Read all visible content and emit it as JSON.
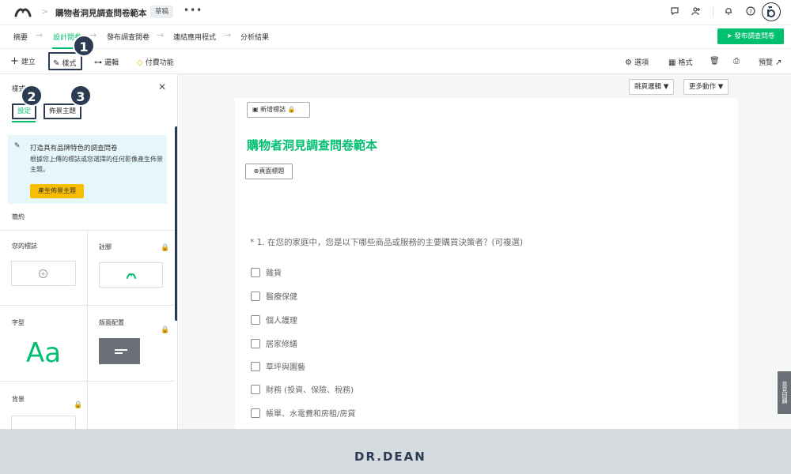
{
  "topbar": {
    "survey_title": "購物者洞見調查問卷範本",
    "draft_badge": "草稿",
    "more": "•••",
    "icons": [
      "chat-icon",
      "add-user-icon",
      "bell-icon",
      "help-icon",
      "user-avatar"
    ]
  },
  "steps": [
    {
      "label": "摘要",
      "active": false
    },
    {
      "label": "設計問卷",
      "active": true
    },
    {
      "label": "發布調查問卷",
      "active": false
    },
    {
      "label": "連結應用程式",
      "active": false
    },
    {
      "label": "分析結果",
      "active": false
    }
  ],
  "publish_button": "發布調查問卷",
  "toolbar": {
    "create": "建立",
    "style": "樣式",
    "logic": "邏輯",
    "paid": "付費功能",
    "options": "選項",
    "format": "格式",
    "preview": "預覽"
  },
  "callouts": [
    "1",
    "2",
    "3"
  ],
  "panel": {
    "title": "樣式",
    "tabs": [
      "設定",
      "佈景主題"
    ],
    "promo_title": "打造具有品牌特色的調查問卷",
    "promo_body": "根據您上傳的標誌或您選擇的任何影像產生佈景主題。",
    "promo_button": "產生佈景主題",
    "summary": "簡約",
    "logo_label": "您的標誌",
    "footer_label": "註腳",
    "font_label": "字型",
    "font_sample": "Aa",
    "layout_label": "版面配置",
    "background_label": "背景"
  },
  "canvas": {
    "page_logic": "跳頁邏輯",
    "more_actions": "更多動作",
    "add_logo": "新增標誌",
    "survey_heading": "購物者洞見調查問卷範本",
    "page_title_btn": "頁面標題",
    "question": "* 1. 在您的家庭中，您是以下哪些商品或服務的主要購買決策者？(可複選)",
    "options": [
      "雜貨",
      "醫療保健",
      "個人護理",
      "居家修繕",
      "草坪與園藝",
      "財務 (投資、保險、稅務)",
      "帳單、水電費和房租/房貸"
    ]
  },
  "feedback_tab": "意見回饋",
  "brand": "DR.DEAN",
  "colors": {
    "accent": "#00bf6f",
    "callout": "#2b3b52",
    "lock": "#f0b400",
    "promo_bg": "#e6f7fb",
    "promo_button": "#f9be00"
  }
}
